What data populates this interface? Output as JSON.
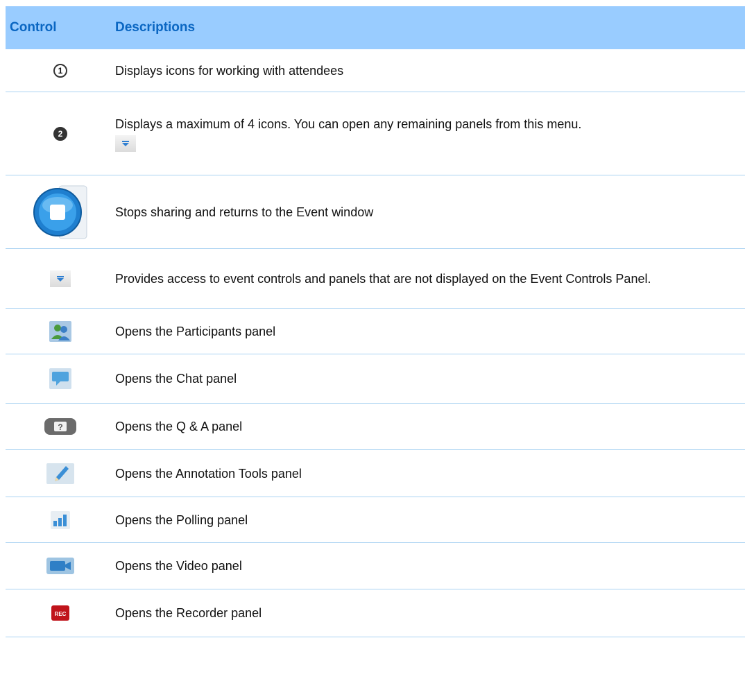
{
  "header": {
    "control": "Control",
    "descriptions": "Descriptions"
  },
  "rows": [
    {
      "icon": "number-1-icon",
      "glyph": "1",
      "description": "Displays icons for working with attendees"
    },
    {
      "icon": "number-2-icon",
      "glyph": "2",
      "description": "Displays a maximum of 4 icons. You can open any remaining panels from this menu."
    },
    {
      "icon": "stop-sharing-icon",
      "description": "Stops sharing and returns to the Event window"
    },
    {
      "icon": "menu-dropdown-icon",
      "description": "Provides access to event controls and panels that are not displayed on the Event Controls Panel."
    },
    {
      "icon": "participants-icon",
      "description": "Opens the Participants panel"
    },
    {
      "icon": "chat-icon",
      "description": "Opens the Chat panel"
    },
    {
      "icon": "qa-icon",
      "glyph": "?",
      "description": "Opens the Q & A panel"
    },
    {
      "icon": "annotation-pencil-icon",
      "description": "Opens the Annotation Tools panel"
    },
    {
      "icon": "polling-icon",
      "description": "Opens the Polling panel"
    },
    {
      "icon": "video-camera-icon",
      "description": "Opens the Video panel"
    },
    {
      "icon": "recorder-icon",
      "glyph": "REC",
      "description": "Opens the Recorder panel"
    }
  ],
  "colors": {
    "header_bg": "#99ccff",
    "header_text": "#0a66c2",
    "row_border": "#a9d2f2"
  }
}
